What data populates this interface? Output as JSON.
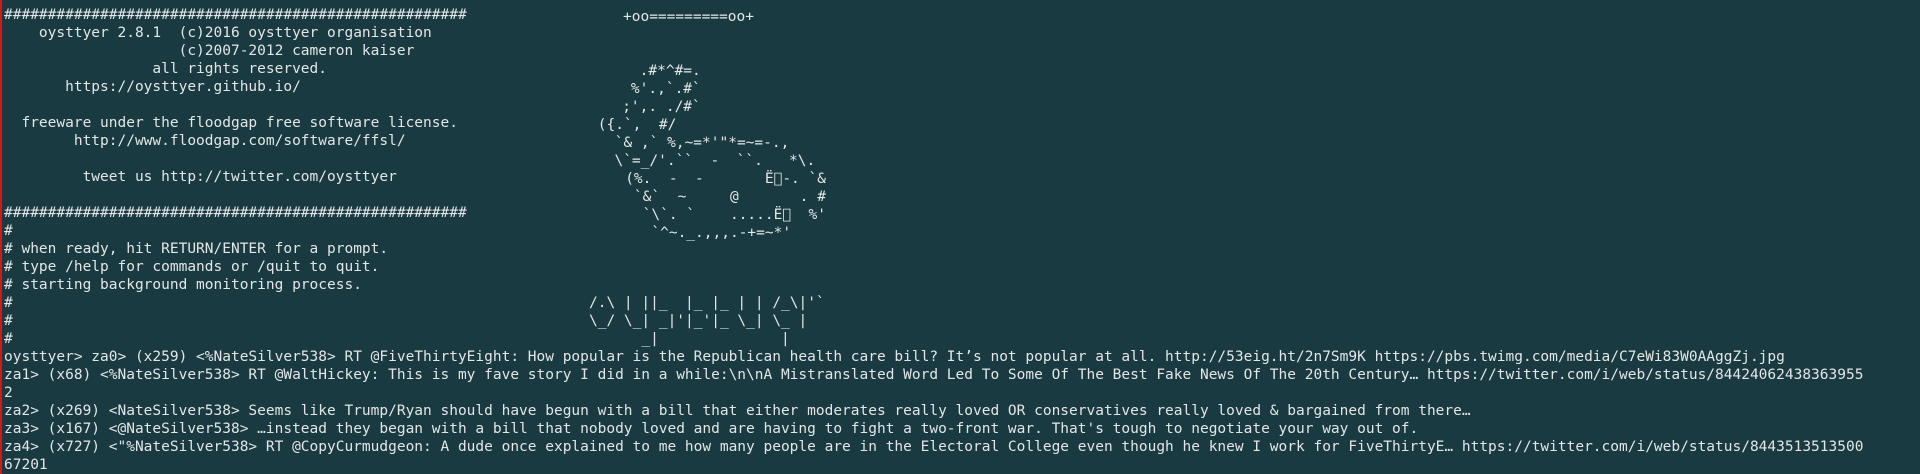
{
  "banner": {
    "hash_rule": "#####################################################",
    "lines": [
      "    oysttyer 2.8.1  (c)2016 oysttyer organisation",
      "                    (c)2007-2012 cameron kaiser",
      "                 all rights reserved.",
      "       https://oysttyer.github.io/",
      "",
      "  freeware under the floodgap free software license.",
      "        http://www.floodgap.com/software/ffsl/",
      "",
      "         tweet us http://twitter.com/oysttyer"
    ]
  },
  "info": [
    "#",
    "# when ready, hit RETURN/ENTER for a prompt.",
    "# type /help for commands or /quit to quit.",
    "# starting background monitoring process.",
    "#",
    "#",
    "#"
  ],
  "oyster_art": [
    "+oo=========oo+",
    "",
    "",
    "     .#*^#=.",
    "    %'.,`.#`",
    "   ;',. ./#`",
    " ({.`,  #/",
    " `& ,` %,~=*'\"*=~=-.,",
    "  \\`=_/'.``  -  ``.   *\\.",
    "   (%.  -  -       Ë⃞-. `&",
    "    `&`  ~     @       . #",
    "     `\\`. `    .....Ë⃞  %'",
    "      `^~._.,,,.-+=~*'"
  ],
  "logo_art": [
    "/.\\ | ||_  |_ |_ | | /_\\|'`",
    "\\_/ \\_| _|'|_'|_ \\_| \\_ |",
    "      _|              |"
  ],
  "tweets": [
    "oysttyer> za0> (x259) <%NateSilver538> RT @FiveThirtyEight: How popular is the Republican health care bill? It’s not popular at all. http://53eig.ht/2n7Sm9K https://pbs.twimg.com/media/C7eWi83W0AAggZj.jpg",
    "za1> (x68) <%NateSilver538> RT @WaltHickey: This is my fave story I did in a while:\\n\\nA Mistranslated Word Led To Some Of The Best Fake News Of The 20th Century… https://twitter.com/i/web/status/84424062438363955",
    "2",
    "za2> (x269) <NateSilver538> Seems like Trump/Ryan should have begun with a bill that either moderates really loved OR conservatives really loved & bargained from there…",
    "za3> (x167) <@NateSilver538> …instead they began with a bill that nobody loved and are having to fight a two-front war. That's tough to negotiate your way out of.",
    "za4> (x727) <\"%NateSilver538> RT @CopyCurmudgeon: A dude once explained to me how many people are in the Electoral College even though he knew I work for FiveThirtyE… https://twitter.com/i/web/status/8443513513500",
    "67201"
  ],
  "colors": {
    "background": "#183a40",
    "foreground": "#e4e6e6",
    "window_edge": "#c02020"
  }
}
